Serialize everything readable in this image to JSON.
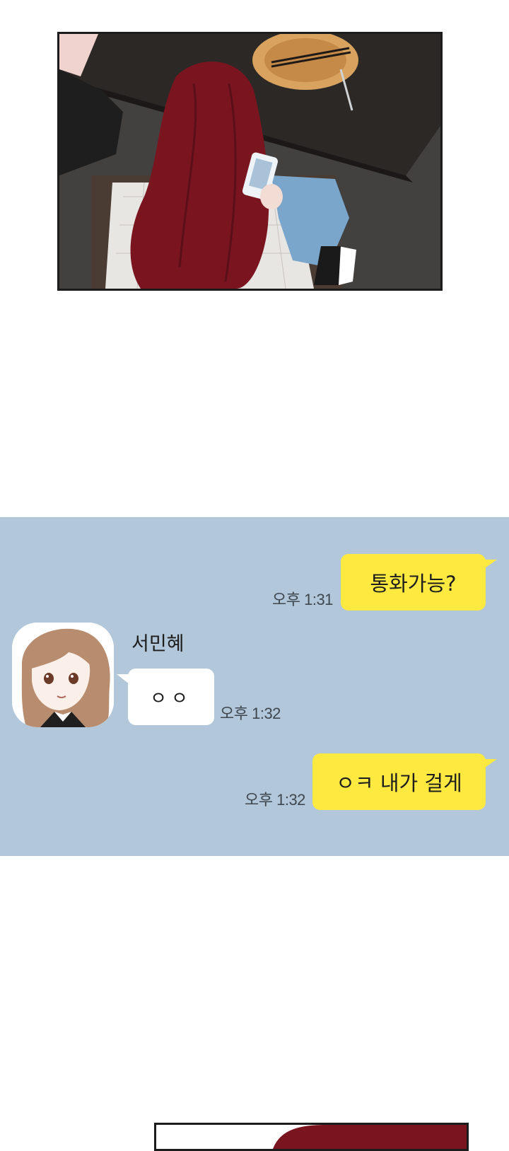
{
  "chat": {
    "messages": [
      {
        "from": "me",
        "text": "통화가능?",
        "time": "오후 1:31"
      },
      {
        "from": "other",
        "sender": "서민혜",
        "text": "ㅇㅇ",
        "time": "오후 1:32"
      },
      {
        "from": "me",
        "text": "ㅇㅋ 내가 걸게",
        "time": "오후 1:32"
      }
    ]
  },
  "colors": {
    "chat_background": "#b2c7d9",
    "my_bubble": "#fee941",
    "other_bubble": "#ffffff",
    "hair": "#7a1520"
  },
  "icons": [
    "profile-avatar",
    "comic-panel-illustration"
  ]
}
